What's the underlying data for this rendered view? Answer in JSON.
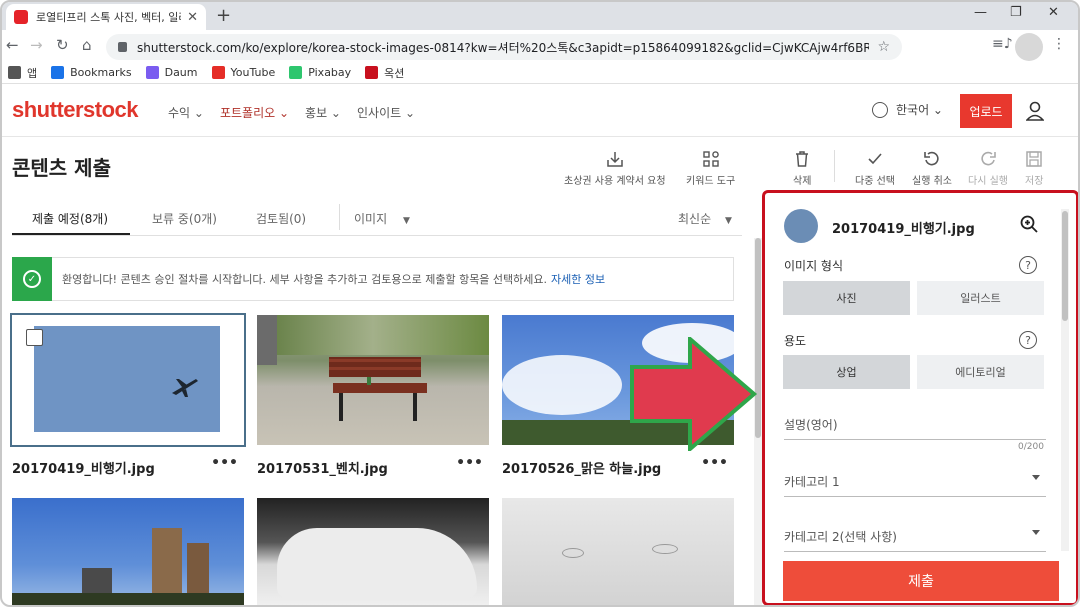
{
  "browser": {
    "tab_title": "로열티프리 스톡 사진, 벡터, 일러",
    "url": "shutterstock.com/ko/explore/korea-stock-images-0814?kw=셔터%20스톡&c3apidt=p15864099182&gclid=CjwKCAjw4rf6BRAvEiwAn2...",
    "new_tab": "+",
    "bookmarks": [
      {
        "label": "앱",
        "icon": "apps-grid-icon",
        "color": "#555555"
      },
      {
        "label": "Bookmarks",
        "icon": "star-icon",
        "color": "#1a73e8"
      },
      {
        "label": "Daum",
        "icon": "daum-icon",
        "color": "#7a5cf0"
      },
      {
        "label": "YouTube",
        "icon": "youtube-icon",
        "color": "#e52d27"
      },
      {
        "label": "Pixabay",
        "icon": "pixabay-icon",
        "color": "#2ec66e"
      },
      {
        "label": "옥션",
        "icon": "auction-icon",
        "color": "#c8101e"
      }
    ]
  },
  "site": {
    "logo": "shutterstock",
    "nav": [
      "수익 ⌄",
      "포트폴리오 ⌄",
      "홍보 ⌄",
      "인사이트 ⌄"
    ],
    "language": "한국어 ⌄",
    "upload": "업로드"
  },
  "page": {
    "title": "콘텐츠 제출",
    "tools": [
      {
        "label": "초상권 사용 계약서 요청",
        "icon": "download-tray-icon"
      },
      {
        "label": "키워드 도구",
        "icon": "grid-shapes-icon"
      },
      {
        "label": "삭제",
        "icon": "trash-icon"
      },
      {
        "label": "다중 선택",
        "icon": "check-icon"
      },
      {
        "label": "실행 취소",
        "icon": "undo-icon"
      },
      {
        "label": "다시 실행",
        "icon": "redo-icon"
      },
      {
        "label": "저장",
        "icon": "save-icon"
      }
    ],
    "tabs": {
      "pending": "제출 예정(8개)",
      "held": "보류 중(0개)",
      "reviewed": "검토됨(0)",
      "media": "이미지",
      "sort": "최신순"
    },
    "notice": {
      "text": "환영합니다! 콘텐츠 승인 절차를 시작합니다. 세부 사항을 추가하고 검토용으로 제출할 항목을 선택하세요.",
      "link": "자세한 정보"
    },
    "images": [
      {
        "name": "20170419_비행기.jpg"
      },
      {
        "name": "20170531_벤치.jpg"
      },
      {
        "name": "20170526_맑은 하늘.jpg"
      },
      {
        "name": ""
      },
      {
        "name": ""
      },
      {
        "name": ""
      }
    ],
    "more": "•••"
  },
  "panel": {
    "file": "20170419_비행기.jpg",
    "image_type_label": "이미지 형식",
    "image_type_options": [
      "사진",
      "일러스트"
    ],
    "usage_label": "용도",
    "usage_options": [
      "상업",
      "에디토리얼"
    ],
    "description_placeholder": "설명(영어)",
    "counter": "0/200",
    "category1": "카테고리 1",
    "category2": "카테고리 2(선택 사항)",
    "submit": "제출",
    "help": "?"
  }
}
